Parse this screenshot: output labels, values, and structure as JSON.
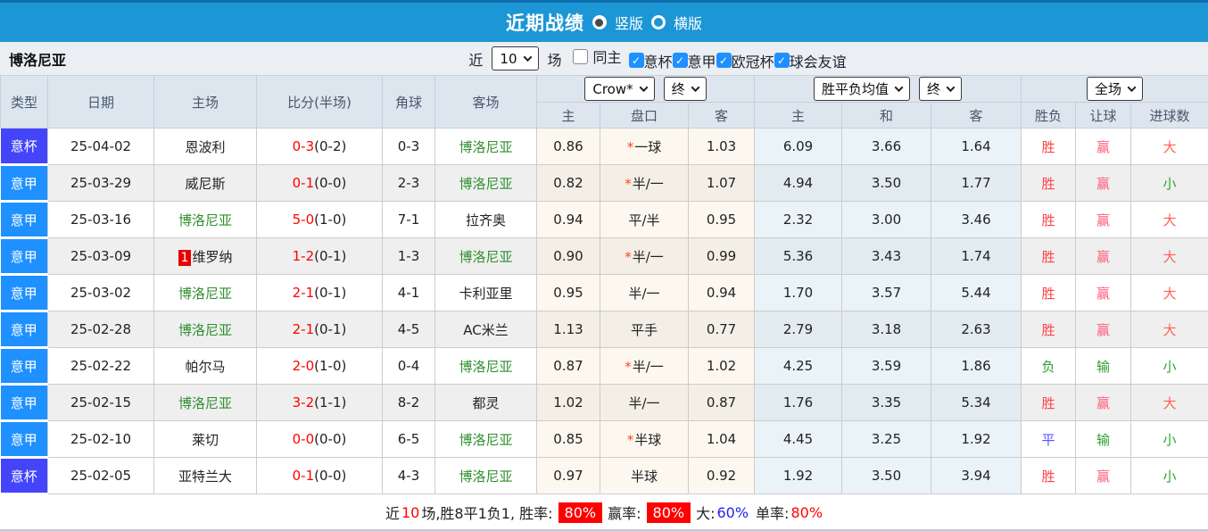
{
  "title_bar": {
    "title": "近期战绩",
    "radios": [
      {
        "label": "竖版",
        "selected": true
      },
      {
        "label": "横版",
        "selected": false
      }
    ]
  },
  "filter_bar": {
    "team": "博洛尼亚",
    "near_label": "近",
    "match_count": "10",
    "field_label": "场",
    "checkboxes": [
      {
        "label": "同主",
        "checked": false
      },
      {
        "label": "意杯",
        "checked": true
      },
      {
        "label": "意甲",
        "checked": true
      },
      {
        "label": "欧冠杯",
        "checked": true
      },
      {
        "label": "球会友谊",
        "checked": true
      }
    ]
  },
  "table": {
    "team_highlight": "博洛尼亚",
    "headers": {
      "type": "类型",
      "date": "日期",
      "home": "主场",
      "score": "比分(半场)",
      "corner": "角球",
      "away": "客场",
      "odds_sub": [
        "主",
        "盘口",
        "客"
      ],
      "avg_sub": [
        "主",
        "和",
        "客"
      ],
      "result_sub": [
        "胜负",
        "让球",
        "进球数"
      ],
      "dropdowns": {
        "odds_source": "Crow*",
        "odds_time": "终",
        "avg_source": "胜平负均值",
        "avg_time": "终",
        "result_scope": "全场"
      }
    },
    "rows": [
      {
        "type": "意杯",
        "date": "25-04-02",
        "home": "恩波利",
        "home_rank": "",
        "score_full": "0-3",
        "score_half": "(0-2)",
        "corner": "0-3",
        "away": "博洛尼亚",
        "odds_home": "0.86",
        "handicap": "一球",
        "handicap_star": true,
        "odds_away": "1.03",
        "avg_home": "6.09",
        "avg_draw": "3.66",
        "avg_away": "1.64",
        "res_wl": "胜",
        "res_handicap": "赢",
        "res_goals": "大"
      },
      {
        "type": "意甲",
        "date": "25-03-29",
        "home": "威尼斯",
        "home_rank": "",
        "score_full": "0-1",
        "score_half": "(0-0)",
        "corner": "2-3",
        "away": "博洛尼亚",
        "odds_home": "0.82",
        "handicap": "半/一",
        "handicap_star": true,
        "odds_away": "1.07",
        "avg_home": "4.94",
        "avg_draw": "3.50",
        "avg_away": "1.77",
        "res_wl": "胜",
        "res_handicap": "赢",
        "res_goals": "小"
      },
      {
        "type": "意甲",
        "date": "25-03-16",
        "home": "博洛尼亚",
        "home_rank": "",
        "score_full": "5-0",
        "score_half": "(1-0)",
        "corner": "7-1",
        "away": "拉齐奥",
        "odds_home": "0.94",
        "handicap": "平/半",
        "handicap_star": false,
        "odds_away": "0.95",
        "avg_home": "2.32",
        "avg_draw": "3.00",
        "avg_away": "3.46",
        "res_wl": "胜",
        "res_handicap": "赢",
        "res_goals": "大"
      },
      {
        "type": "意甲",
        "date": "25-03-09",
        "home": "维罗纳",
        "home_rank": "1",
        "score_full": "1-2",
        "score_half": "(0-1)",
        "corner": "1-3",
        "away": "博洛尼亚",
        "odds_home": "0.90",
        "handicap": "半/一",
        "handicap_star": true,
        "odds_away": "0.99",
        "avg_home": "5.36",
        "avg_draw": "3.43",
        "avg_away": "1.74",
        "res_wl": "胜",
        "res_handicap": "赢",
        "res_goals": "大"
      },
      {
        "type": "意甲",
        "date": "25-03-02",
        "home": "博洛尼亚",
        "home_rank": "",
        "score_full": "2-1",
        "score_half": "(0-1)",
        "corner": "4-1",
        "away": "卡利亚里",
        "odds_home": "0.95",
        "handicap": "半/一",
        "handicap_star": false,
        "odds_away": "0.94",
        "avg_home": "1.70",
        "avg_draw": "3.57",
        "avg_away": "5.44",
        "res_wl": "胜",
        "res_handicap": "赢",
        "res_goals": "大"
      },
      {
        "type": "意甲",
        "date": "25-02-28",
        "home": "博洛尼亚",
        "home_rank": "",
        "score_full": "2-1",
        "score_half": "(0-1)",
        "corner": "4-5",
        "away": "AC米兰",
        "odds_home": "1.13",
        "handicap": "平手",
        "handicap_star": false,
        "odds_away": "0.77",
        "avg_home": "2.79",
        "avg_draw": "3.18",
        "avg_away": "2.63",
        "res_wl": "胜",
        "res_handicap": "赢",
        "res_goals": "大"
      },
      {
        "type": "意甲",
        "date": "25-02-22",
        "home": "帕尔马",
        "home_rank": "",
        "score_full": "2-0",
        "score_half": "(1-0)",
        "corner": "0-4",
        "away": "博洛尼亚",
        "odds_home": "0.87",
        "handicap": "半/一",
        "handicap_star": true,
        "odds_away": "1.02",
        "avg_home": "4.25",
        "avg_draw": "3.59",
        "avg_away": "1.86",
        "res_wl": "负",
        "res_handicap": "输",
        "res_goals": "小"
      },
      {
        "type": "意甲",
        "date": "25-02-15",
        "home": "博洛尼亚",
        "home_rank": "",
        "score_full": "3-2",
        "score_half": "(1-1)",
        "corner": "8-2",
        "away": "都灵",
        "odds_home": "1.02",
        "handicap": "半/一",
        "handicap_star": false,
        "odds_away": "0.87",
        "avg_home": "1.76",
        "avg_draw": "3.35",
        "avg_away": "5.34",
        "res_wl": "胜",
        "res_handicap": "赢",
        "res_goals": "大"
      },
      {
        "type": "意甲",
        "date": "25-02-10",
        "home": "莱切",
        "home_rank": "",
        "score_full": "0-0",
        "score_half": "(0-0)",
        "corner": "6-5",
        "away": "博洛尼亚",
        "odds_home": "0.85",
        "handicap": "半球",
        "handicap_star": true,
        "odds_away": "1.04",
        "avg_home": "4.45",
        "avg_draw": "3.25",
        "avg_away": "1.92",
        "res_wl": "平",
        "res_handicap": "输",
        "res_goals": "小"
      },
      {
        "type": "意杯",
        "date": "25-02-05",
        "home": "亚特兰大",
        "home_rank": "",
        "score_full": "0-1",
        "score_half": "(0-0)",
        "corner": "4-3",
        "away": "博洛尼亚",
        "odds_home": "0.97",
        "handicap": "半球",
        "handicap_star": false,
        "odds_away": "0.92",
        "avg_home": "1.92",
        "avg_draw": "3.50",
        "avg_away": "3.94",
        "res_wl": "胜",
        "res_handicap": "赢",
        "res_goals": "小"
      }
    ]
  },
  "summary": {
    "near_label": "近",
    "count": "10",
    "record_text": "场,胜8平1负1, 胜率:",
    "win_rate": "80%",
    "ying_label": "赢率:",
    "ying_rate": "80%",
    "da_label": "大:",
    "da_rate": "60%",
    "dan_label": "单率:",
    "dan_rate": "80%"
  },
  "colors": {
    "header_bar": "#1d96d5",
    "league_badge": "#1e90ff",
    "cup_badge": "#4444fa",
    "team_highlight": "#2f8f2f",
    "score_red": "#ff0000",
    "win": "#ff4343",
    "lose": "#2f9e2f",
    "draw": "#5555ff",
    "rate_badge_bg": "#ff0000",
    "rate_blue": "#2222ee"
  }
}
